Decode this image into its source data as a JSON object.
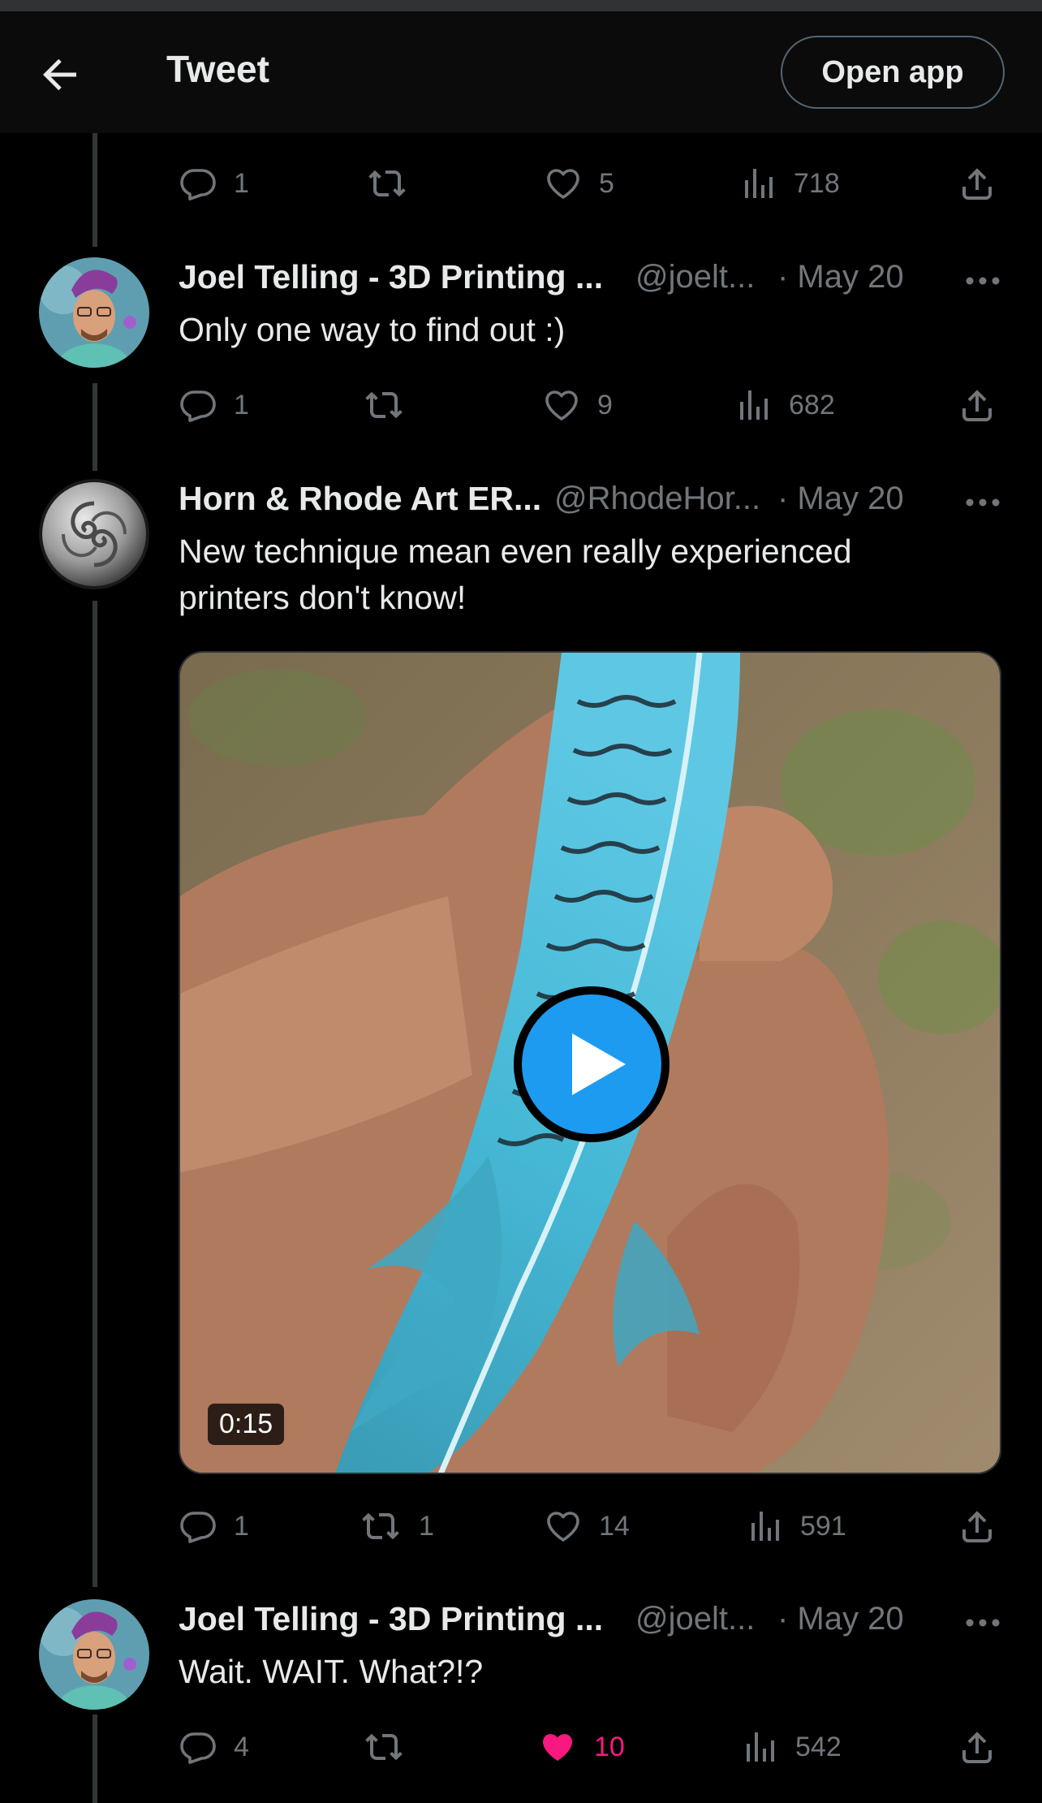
{
  "header": {
    "title": "Tweet",
    "open_app_label": "Open app"
  },
  "prev_actions": {
    "replies": "1",
    "retweets": "",
    "likes": "5",
    "views": "718"
  },
  "tweets": [
    {
      "name": "Joel Telling - 3D Printing ...",
      "handle": "@joelt...",
      "date": "· May 20",
      "text": "Only one way to find out :)",
      "actions": {
        "replies": "1",
        "retweets": "",
        "likes": "9",
        "views": "682"
      }
    },
    {
      "name": "Horn & Rhode Art ER...",
      "handle": "@RhodeHor...",
      "date": "· May 20",
      "text_line1": "New technique mean even really experienced",
      "text_line2": "printers don't know!",
      "video_duration": "0:15",
      "actions": {
        "replies": "1",
        "retweets": "1",
        "likes": "14",
        "views": "591"
      }
    },
    {
      "name": "Joel Telling - 3D Printing ...",
      "handle": "@joelt...",
      "date": "· May 20",
      "text": "Wait. WAIT. What?!?",
      "actions": {
        "replies": "4",
        "retweets": "",
        "likes": "10",
        "views": "542",
        "liked": true
      }
    }
  ],
  "colors": {
    "background": "#000000",
    "text": "#e7e9ea",
    "muted": "#71767b",
    "like_active": "#f91880",
    "play": "#1d9bf0"
  }
}
